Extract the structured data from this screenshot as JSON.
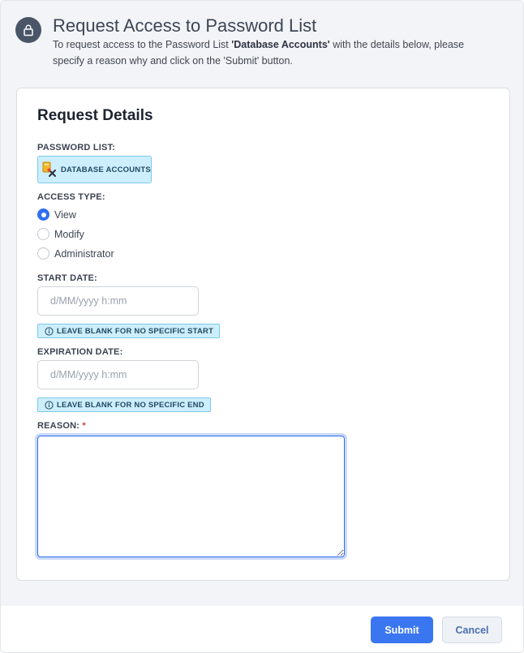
{
  "header": {
    "title": "Request Access to Password List",
    "subtitle_pre": "To request access to the Password List ",
    "subtitle_list_name": "'Database Accounts'",
    "subtitle_post": " with the details below, please specify a reason why and click on the 'Submit' button."
  },
  "card": {
    "title": "Request Details",
    "password_list": {
      "label": "PASSWORD LIST:",
      "value": "DATABASE ACCOUNTS"
    },
    "access_type": {
      "label": "ACCESS TYPE:",
      "options": [
        "View",
        "Modify",
        "Administrator"
      ],
      "selected": "View"
    },
    "start_date": {
      "label": "START DATE:",
      "placeholder": "d/MM/yyyy h:mm",
      "value": "",
      "hint": "LEAVE BLANK FOR NO SPECIFIC START"
    },
    "expiration_date": {
      "label": "EXPIRATION DATE:",
      "placeholder": "d/MM/yyyy h:mm",
      "value": "",
      "hint": "LEAVE BLANK FOR NO SPECIFIC END"
    },
    "reason": {
      "label": "REASON:",
      "required_mark": "*",
      "value": ""
    }
  },
  "footer": {
    "submit_label": "Submit",
    "cancel_label": "Cancel"
  },
  "colors": {
    "accent": "#3a76f0",
    "info_bg": "#cdeefc",
    "required": "#d23b3b"
  },
  "icons": {
    "header": "lock-icon",
    "password_list": "password-list-icon",
    "hint": "info-icon"
  }
}
